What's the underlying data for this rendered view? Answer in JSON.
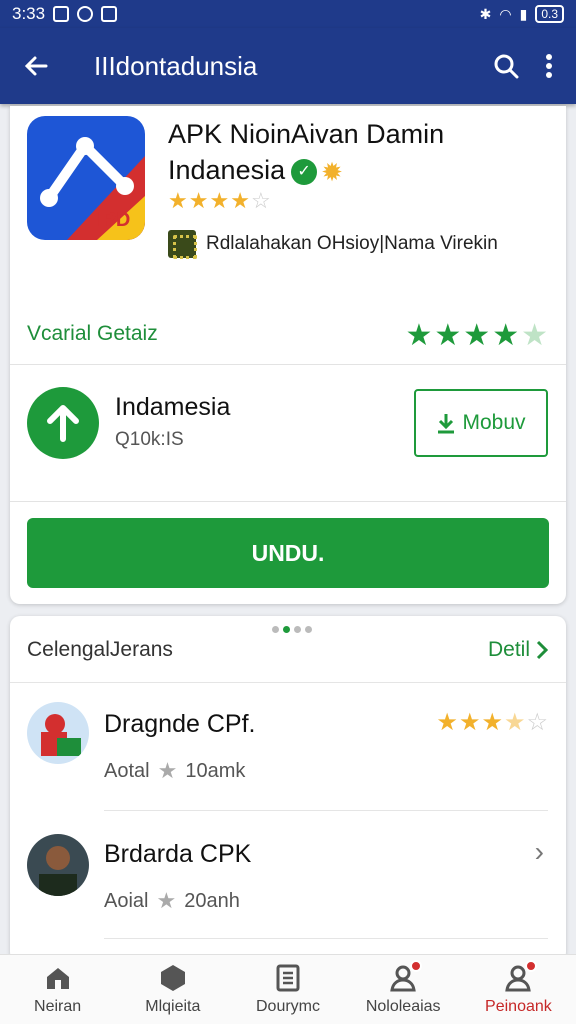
{
  "status": {
    "time": "3:33",
    "battery": "0.3"
  },
  "appbar": {
    "title": "IIIdontadunsia",
    "back_icon": "back-arrow-icon",
    "search_icon": "search-icon",
    "more_icon": "more-vert-icon"
  },
  "app": {
    "name": "APK NioinAivan Damin Indanesia",
    "icon_text": "IPD",
    "rating": 3.5,
    "publisher": "Rdlalahakan OHsioy|Nama Virekin",
    "colors": {
      "primary": "#1f3a8a",
      "accent": "#1e9a3b",
      "star": "#f2b12c"
    }
  },
  "version": {
    "label": "Vcarial Getaiz",
    "rating": 4
  },
  "download": {
    "name": "Indamesia",
    "size": "Q10k:IS",
    "modify_label": "Mobuv",
    "button_label": "UNDU."
  },
  "section": {
    "title": "CelengalJerans",
    "link_label": "Detil"
  },
  "list": [
    {
      "name": "Dragnde CPf.",
      "meta": "Aotal",
      "meta2": "10amk",
      "rating": 3.5
    },
    {
      "name": "Brdarda CPK",
      "meta": "Aoial",
      "meta2": "20anh"
    }
  ],
  "nav": [
    {
      "label": "Neiran",
      "icon": "home-icon"
    },
    {
      "label": "Mlqieita",
      "icon": "hexagon-icon"
    },
    {
      "label": "Dourymc",
      "icon": "document-icon"
    },
    {
      "label": "Nololeaias",
      "icon": "user-alert-icon"
    },
    {
      "label": "Peinoank",
      "icon": "profile-icon"
    }
  ]
}
